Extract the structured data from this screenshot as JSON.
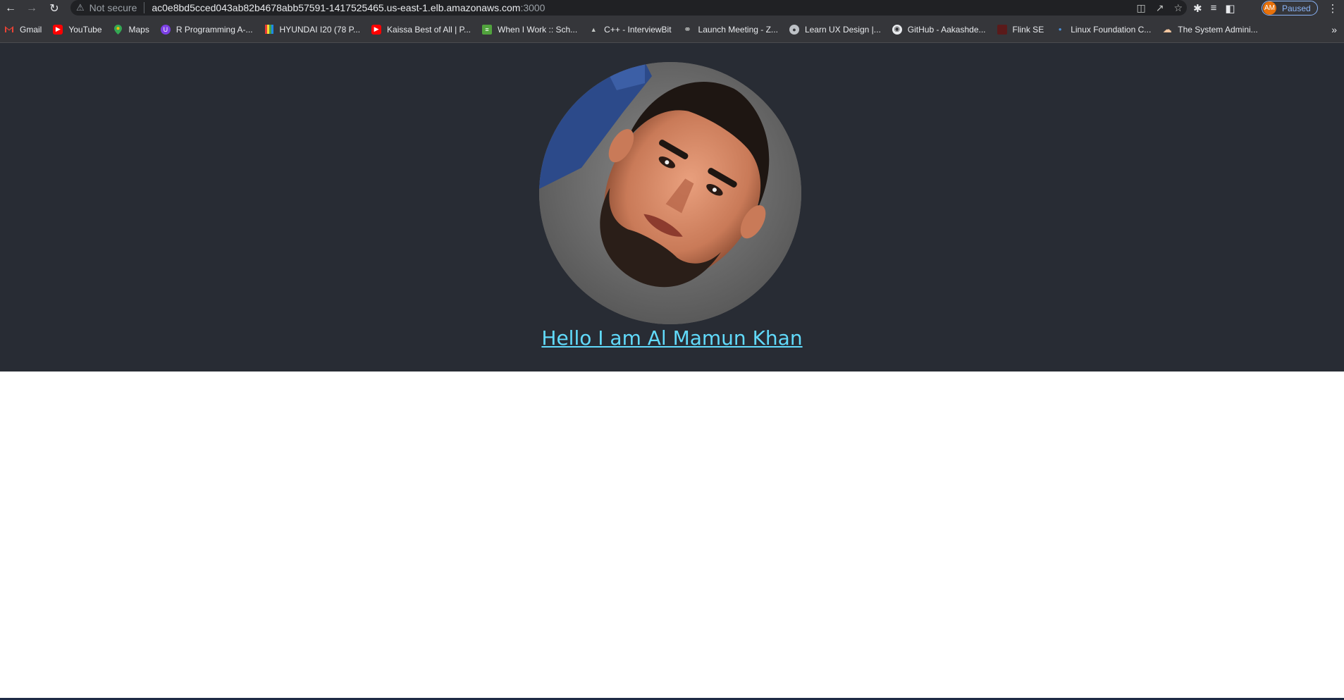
{
  "browser": {
    "security_label": "Not secure",
    "url_host": "ac0e8bd5cced043ab82b4678abb57591-1417525465.us-east-1.elb.amazonaws.com",
    "url_port": ":3000",
    "profile_initials": "AM",
    "profile_status": "Paused"
  },
  "bookmarks": [
    {
      "label": "Gmail",
      "icon": "gmail-icon",
      "color": "#ea4335"
    },
    {
      "label": "YouTube",
      "icon": "youtube-icon",
      "color": "#ff0000"
    },
    {
      "label": "Maps",
      "icon": "maps-icon",
      "color": "#34a853"
    },
    {
      "label": "R Programming A-...",
      "icon": "r-programming-icon",
      "color": "#7b3fe4"
    },
    {
      "label": "HYUNDAI I20 (78 P...",
      "icon": "hyundai-icon",
      "color": "#e0a020"
    },
    {
      "label": "Kaissa Best of All | P...",
      "icon": "youtube-icon",
      "color": "#ff0000"
    },
    {
      "label": "When I Work :: Sch...",
      "icon": "when-i-work-icon",
      "color": "#51a33d"
    },
    {
      "label": "C++ - InterviewBit",
      "icon": "interviewbit-icon",
      "color": "#9aa0a6"
    },
    {
      "label": "Launch Meeting - Z...",
      "icon": "globe-icon",
      "color": "#9aa0a6"
    },
    {
      "label": "Learn UX Design |...",
      "icon": "ux-design-icon",
      "color": "#bdc1c6"
    },
    {
      "label": "GitHub - Aakashde...",
      "icon": "github-icon",
      "color": "#e8eaed"
    },
    {
      "label": "Flink SE",
      "icon": "flink-icon",
      "color": "#b3261e"
    },
    {
      "label": "Linux Foundation C...",
      "icon": "linux-foundation-icon",
      "color": "#4a90d9"
    },
    {
      "label": "The System Admini...",
      "icon": "cloud-icon",
      "color": "#f2c6a0"
    }
  ],
  "page": {
    "greeting": "Hello I am Al Mamun Khan",
    "hero_bg": "#282c34",
    "link_color": "#61dafb"
  }
}
